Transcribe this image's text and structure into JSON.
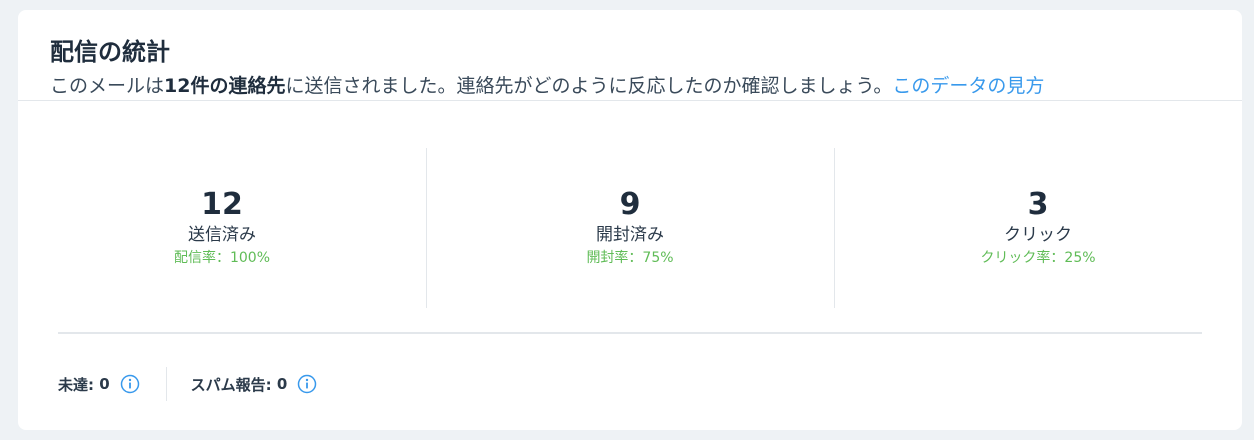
{
  "header": {
    "title": "配信の統計",
    "subtitle_pre": "このメールは",
    "subtitle_bold": "12件の連絡先",
    "subtitle_post": "に送信されました。連絡先がどのように反応したのか確認しましょう。",
    "link": "このデータの見方"
  },
  "stats": [
    {
      "value": "12",
      "label": "送信済み",
      "rate": "配信率：100%"
    },
    {
      "value": "9",
      "label": "開封済み",
      "rate": "開封率：75%"
    },
    {
      "value": "3",
      "label": "クリック",
      "rate": "クリック率：25%"
    }
  ],
  "footer": {
    "undelivered_label": "未達:",
    "undelivered_value": "0",
    "spam_label": "スパム報告:",
    "spam_value": "0"
  },
  "colors": {
    "accent": "#3899ec",
    "rate_green": "#60bc57",
    "text_dark": "#1f2d3d"
  },
  "icons": [
    "info-icon"
  ]
}
